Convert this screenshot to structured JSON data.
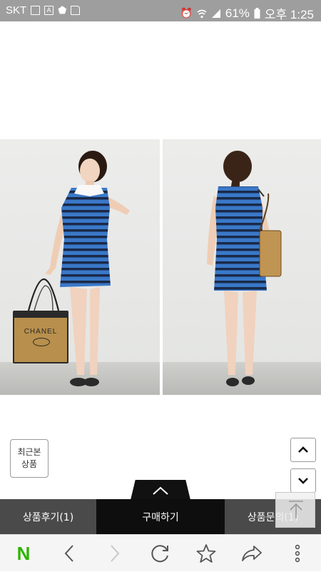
{
  "status_bar": {
    "carrier": "SKT",
    "battery": "61%",
    "time": "오후 1:25"
  },
  "product_image": {
    "bag_brand_text": "CHANEL"
  },
  "floating": {
    "recent_line1": "최근본",
    "recent_line2": "상품"
  },
  "tabs": {
    "review": "상품후기(1)",
    "buy": "구매하기",
    "qna": "상품문의(1)"
  },
  "browser_nav": {
    "logo_letter": "N"
  },
  "colors": {
    "status_bar": "#9e9e9e",
    "naver_green": "#2db400",
    "dress_blue": "#3a78c8",
    "dress_navy": "#1a2a48",
    "tab_active": "#0e0e0e",
    "tab_inactive": "#4a4a4a"
  },
  "icons": [
    "image-icon",
    "a-icon",
    "shield-icon",
    "sd-card-icon",
    "alarm-icon",
    "wifi-icon",
    "signal-icon",
    "battery-icon",
    "chevron-up-icon",
    "chevron-down-icon",
    "arrow-up-to-top-icon",
    "back-icon",
    "forward-icon",
    "refresh-icon",
    "star-icon",
    "share-icon",
    "more-vertical-icon"
  ]
}
